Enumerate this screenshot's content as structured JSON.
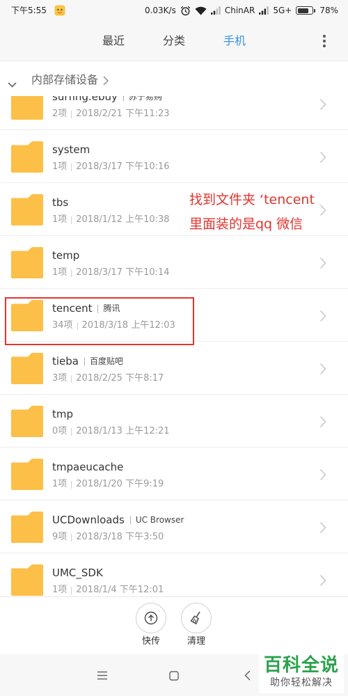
{
  "status_bar": {
    "time": "下午5:55",
    "net_speed": "0.03K/s",
    "carrier": "ChinAR",
    "network": "5G+",
    "battery": "78%",
    "battery_level": 0.78,
    "icons": [
      "app-notification-icon",
      "alarm-icon",
      "wifi-icon",
      "signal-icon",
      "signal-icon",
      "battery-icon"
    ]
  },
  "header": {
    "tabs": [
      {
        "label": "最近",
        "active": false
      },
      {
        "label": "分类",
        "active": false
      },
      {
        "label": "手机",
        "active": true
      }
    ],
    "menu_icon": "more-vert-icon"
  },
  "breadcrumb": {
    "toggle_icon": "chevron-down-icon",
    "path": "内部存储设备",
    "arrow_icon": "chevron-right-icon"
  },
  "files": [
    {
      "name": "surfing.ebuy",
      "tag": "苏宁易购",
      "count": "2项",
      "date": "2018/2/21 下午11:23"
    },
    {
      "name": "system",
      "tag": "",
      "count": "1项",
      "date": "2018/3/17 下午10:16"
    },
    {
      "name": "tbs",
      "tag": "",
      "count": "1项",
      "date": "2018/1/12 上午10:38"
    },
    {
      "name": "temp",
      "tag": "",
      "count": "1项",
      "date": "2018/3/17 下午10:14"
    },
    {
      "name": "tencent",
      "tag": "腾讯",
      "count": "34项",
      "date": "2018/3/18 上午12:03"
    },
    {
      "name": "tieba",
      "tag": "百度贴吧",
      "count": "3项",
      "date": "2018/2/25 下午8:17"
    },
    {
      "name": "tmp",
      "tag": "",
      "count": "0项",
      "date": "2018/1/13 上午12:21"
    },
    {
      "name": "tmpaeucache",
      "tag": "",
      "count": "1项",
      "date": "2018/1/20 下午9:19"
    },
    {
      "name": "UCDownloads",
      "tag": "UC Browser",
      "count": "9项",
      "date": "2018/3/18 下午3:50"
    },
    {
      "name": "UMC_SDK",
      "tag": "",
      "count": "1项",
      "date": "2018/1/4 下午12:01"
    }
  ],
  "annotation": {
    "line1": "找到文件夹 ‘tencent",
    "line2": "里面装的是qq  微信"
  },
  "actions": [
    {
      "label": "快传",
      "icon": "upload-circle-icon"
    },
    {
      "label": "清理",
      "icon": "broom-icon"
    }
  ],
  "nav_bar": {
    "icons": [
      "menu-icon",
      "home-square-icon",
      "back-icon"
    ]
  },
  "watermark": {
    "title": "百科全说",
    "subtitle": "助你轻松解决"
  },
  "colors": {
    "accent": "#3a93de",
    "annotation": "#e3342f",
    "folder": "#fcbf48",
    "watermark": "#2ba24c"
  }
}
